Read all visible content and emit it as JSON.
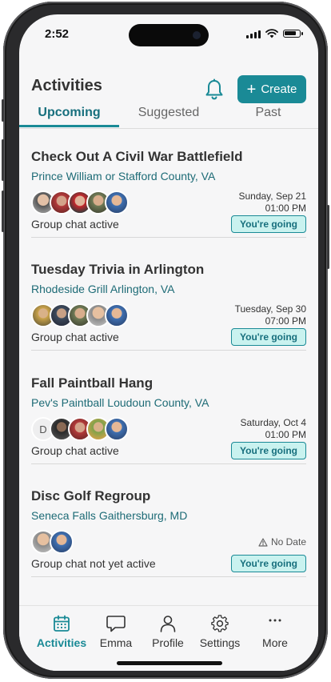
{
  "status": {
    "time": "2:52"
  },
  "header": {
    "title": "Activities",
    "create_label": "Create"
  },
  "tabs": [
    {
      "label": "Upcoming",
      "active": true
    },
    {
      "label": "Suggested",
      "active": false
    },
    {
      "label": "Past",
      "active": false
    }
  ],
  "activities": [
    {
      "title": "Check Out A Civil War Battlefield",
      "location": "Prince William or Stafford County, VA",
      "date": "Sunday, Sep 21",
      "time": "01:00 PM",
      "chat_status": "Group chat active",
      "rsvp": "You're going"
    },
    {
      "title": "Tuesday Trivia in Arlington",
      "location": "Rhodeside Grill Arlington, VA",
      "date": "Tuesday, Sep 30",
      "time": "07:00 PM",
      "chat_status": "Group chat active",
      "rsvp": "You're going"
    },
    {
      "title": "Fall Paintball Hang",
      "location": "Pev's Paintball Loudoun County, VA",
      "date": "Saturday, Oct 4",
      "time": "01:00 PM",
      "chat_status": "Group chat active",
      "rsvp": "You're going",
      "avatar_initial": "D"
    },
    {
      "title": "Disc Golf Regroup",
      "location": "Seneca Falls Gaithersburg, MD",
      "date": "No Date",
      "chat_status": "Group chat not yet active",
      "rsvp": "You're going"
    }
  ],
  "tabbar": [
    {
      "label": "Activities",
      "icon": "calendar-icon",
      "active": true
    },
    {
      "label": "Emma",
      "icon": "chat-bubble-icon",
      "active": false
    },
    {
      "label": "Profile",
      "icon": "person-icon",
      "active": false
    },
    {
      "label": "Settings",
      "icon": "gear-icon",
      "active": false
    },
    {
      "label": "More",
      "icon": "ellipsis-icon",
      "active": false
    }
  ],
  "colors": {
    "accent": "#1a8a96",
    "accent_dark": "#176f7d",
    "badge_bg": "#c9f2ef"
  }
}
